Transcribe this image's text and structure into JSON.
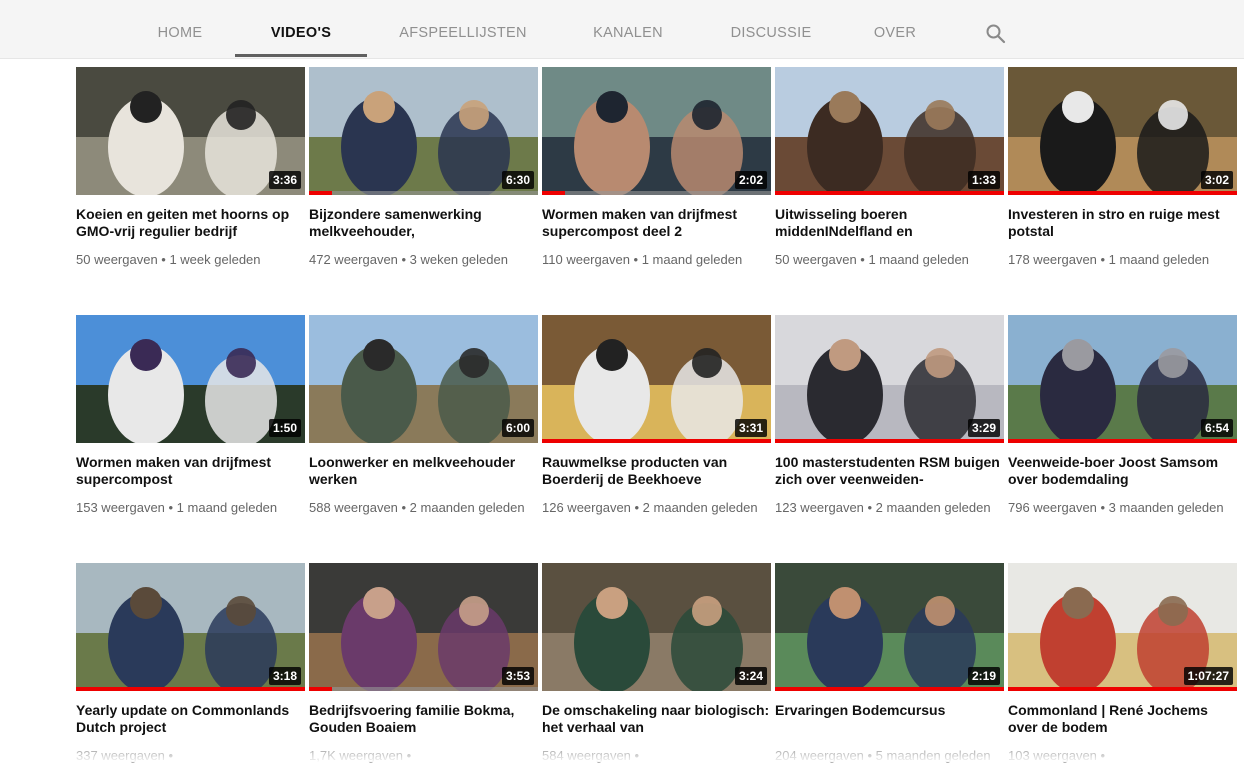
{
  "tabs": [
    {
      "label": "HOME",
      "active": false
    },
    {
      "label": "VIDEO'S",
      "active": true
    },
    {
      "label": "AFSPEELLIJSTEN",
      "active": false
    },
    {
      "label": "KANALEN",
      "active": false
    },
    {
      "label": "DISCUSSIE",
      "active": false
    },
    {
      "label": "OVER",
      "active": false
    }
  ],
  "search_icon": "search-icon",
  "colors": {
    "progress": "#e00000",
    "tab_bar": "#f5f5f5",
    "active_tab_underline": "#606060"
  },
  "videos": [
    {
      "title": "Koeien en geiten met hoorns op GMO-vrij regulier bedrijf",
      "meta": "50 weergaven • 1 week geleden",
      "duration": "3:36",
      "watched": 0
    },
    {
      "title": "Bijzondere samenwerking melkveehouder,",
      "meta": "472 weergaven • 3 weken geleden",
      "duration": "6:30",
      "watched": 0.1
    },
    {
      "title": "Wormen maken van drijfmest supercompost deel 2",
      "meta": "110 weergaven • 1 maand geleden",
      "duration": "2:02",
      "watched": 0.1
    },
    {
      "title": "Uitwisseling boeren middenINdelfland en",
      "meta": "50 weergaven • 1 maand geleden",
      "duration": "1:33",
      "watched": 1
    },
    {
      "title": "Investeren in stro en ruige mest potstal",
      "meta": "178 weergaven • 1 maand geleden",
      "duration": "3:02",
      "watched": 1
    },
    {
      "title": "Wormen maken van drijfmest supercompost",
      "meta": "153 weergaven • 1 maand geleden",
      "duration": "1:50",
      "watched": 0
    },
    {
      "title": "Loonwerker en melkveehouder werken",
      "meta": "588 weergaven • 2 maanden geleden",
      "duration": "6:00",
      "watched": 0
    },
    {
      "title": "Rauwmelkse producten van Boerderij de Beekhoeve",
      "meta": "126 weergaven • 2 maanden geleden",
      "duration": "3:31",
      "watched": 1
    },
    {
      "title": "100 masterstudenten RSM buigen zich over veenweiden-",
      "meta": "123 weergaven • 2 maanden geleden",
      "duration": "3:29",
      "watched": 1
    },
    {
      "title": "Veenweide-boer Joost Samsom over bodemdaling",
      "meta": "796 weergaven • 3 maanden geleden",
      "duration": "6:54",
      "watched": 1
    },
    {
      "title": "Yearly update on Commonlands Dutch project",
      "meta": "337 weergaven •",
      "duration": "3:18",
      "watched": 1
    },
    {
      "title": "Bedrijfsvoering familie Bokma, Gouden Boaiem",
      "meta": "1,7K weergaven •",
      "duration": "3:53",
      "watched": 0.1
    },
    {
      "title": "De omschakeling naar biologisch: het verhaal van",
      "meta": "584 weergaven •",
      "duration": "3:24",
      "watched": 0
    },
    {
      "title": "Ervaringen Bodemcursus",
      "meta": "204 weergaven • 5 maanden geleden",
      "duration": "2:19",
      "watched": 1
    },
    {
      "title": "Commonland | René Jochems over de bodem",
      "meta": "103 weergaven •",
      "duration": "1:07:27",
      "watched": 1
    }
  ]
}
